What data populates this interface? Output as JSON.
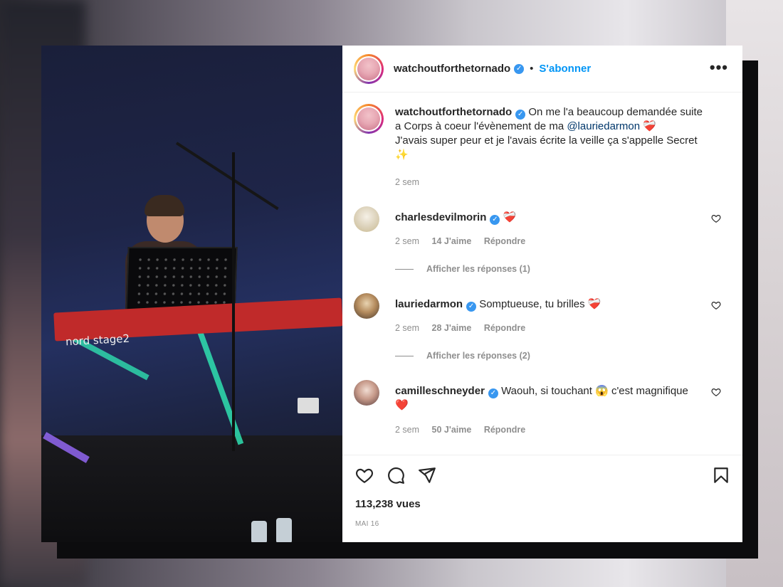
{
  "post": {
    "username": "watchoutforthetornado",
    "verified_mark": "✓",
    "dot": "•",
    "follow_label": "S'abonner",
    "more_label": "•••",
    "media": {
      "keyboard_brand": "nord stage2"
    }
  },
  "caption": {
    "username": "watchoutforthetornado",
    "text_part1": "On me l'a beaucoup demandée suite a Corps à coeur l'évènement de ma ",
    "mention": "@lauriedarmon",
    "text_part2": "J'avais super peur et je l'avais écrite la veille ça s'appelle Secret",
    "emoji_end": "✨",
    "time": "2 sem"
  },
  "comments": [
    {
      "username": "charlesdevilmorin",
      "text": "",
      "emoji": "❤️‍🩹",
      "time": "2 sem",
      "likes": "14 J'aime",
      "reply": "Répondre",
      "show_replies": "Afficher les réponses (1)"
    },
    {
      "username": "lauriedarmon",
      "text": "Somptueuse, tu brilles",
      "emoji": "❤️‍🩹",
      "time": "2 sem",
      "likes": "28 J'aime",
      "reply": "Répondre",
      "show_replies": "Afficher les réponses (2)"
    },
    {
      "username": "camilleschneyder",
      "text": "Waouh, si touchant 😱 c'est magnifique",
      "emoji": "❤️",
      "time": "2 sem",
      "likes": "50 J'aime",
      "reply": "Répondre"
    }
  ],
  "footer": {
    "views": "113,238 vues",
    "date": "MAI 16"
  },
  "icons": {
    "like": "heart-icon",
    "comment": "comment-icon",
    "share": "share-icon",
    "save": "bookmark-icon",
    "more": "more-icon"
  },
  "colors": {
    "follow": "#0095f6",
    "verified": "#3897f0",
    "muted": "#8e8e8e",
    "mention": "#00376b"
  }
}
